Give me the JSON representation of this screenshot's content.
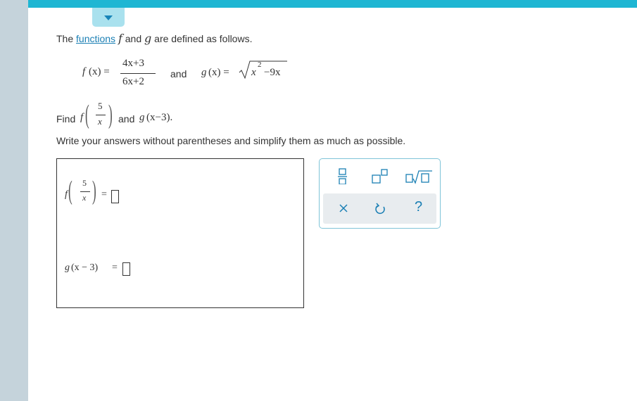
{
  "intro": {
    "before_link": "The ",
    "link": "functions",
    "f": "f",
    "and": "and",
    "g": "g",
    "after": "are defined as follows."
  },
  "f_def": {
    "lhs_f": "f",
    "lhs_args": "(x) =",
    "numerator": "4x+3",
    "denominator": "6x+2"
  },
  "connector": "and",
  "g_def": {
    "lhs_g": "g",
    "lhs_args": "(x) =",
    "radicand_x": "x",
    "exponent": "2",
    "radicand_rest": "−9x"
  },
  "find": {
    "label": "Find",
    "f": "f",
    "frac_num": "5",
    "frac_den": "x",
    "and": "and",
    "g": "g",
    "g_args": "(x−3)."
  },
  "instruction": "Write your answers without parentheses and simplify them as much as possible.",
  "answers": {
    "a": {
      "f": "f",
      "frac_num": "5",
      "frac_den": "x",
      "equals": "="
    },
    "b": {
      "g": "g",
      "args": "(x − 3)",
      "equals": "="
    }
  },
  "palette": {
    "tools": [
      "fraction-icon",
      "superscript-icon",
      "sqrt-icon"
    ],
    "actions": [
      "clear-icon",
      "undo-icon",
      "help-icon"
    ],
    "help_label": "?",
    "clear_label": "✕",
    "accent": "#1a7fb4",
    "border": "#7fc4d8",
    "footer_bg": "#e8ecef"
  },
  "colors": {
    "top_bar": "#1eb6d3",
    "left_rail": "#c5d3db",
    "tab": "#a9e1ee",
    "link": "#1a7fb4"
  }
}
